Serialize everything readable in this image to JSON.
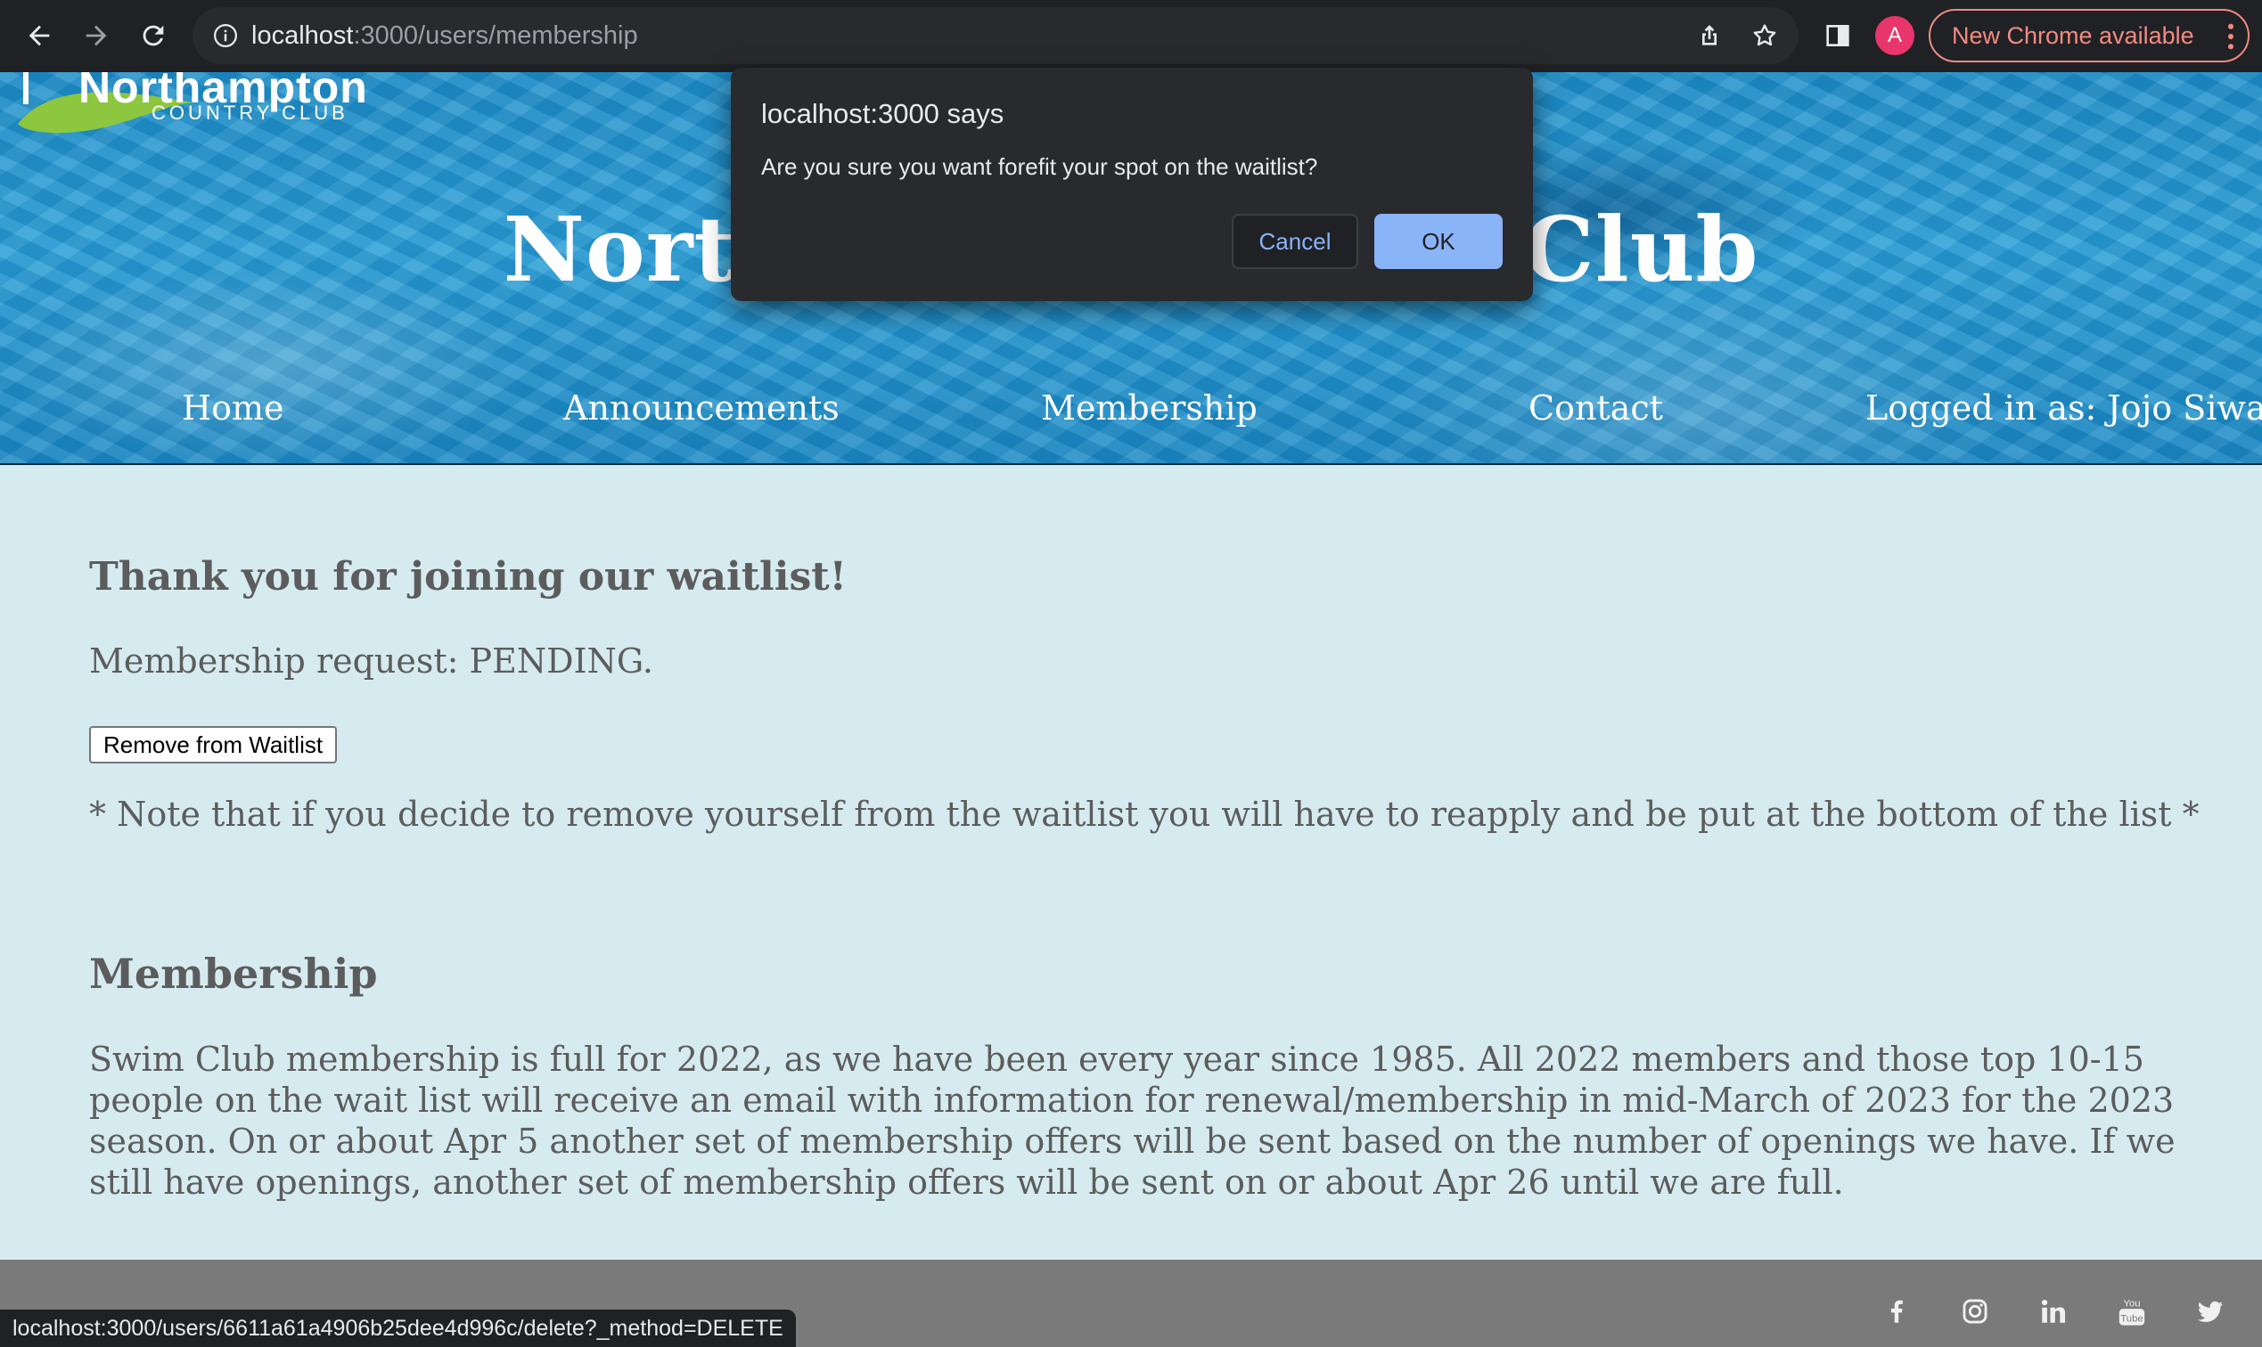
{
  "browser": {
    "url_host": "localhost",
    "url_path": ":3000/users/membership",
    "avatar_letter": "A",
    "update_label": "New Chrome available",
    "status_bar_url": "localhost:3000/users/6611a61a4906b25dee4d996c/delete?_method=DELETE"
  },
  "logo": {
    "word": "Northampton",
    "sub": "COUNTRY CLUB"
  },
  "hero": {
    "title": "Northampton Swim Club"
  },
  "nav": {
    "home": "Home",
    "announcements": "Announcements",
    "membership": "Membership",
    "contact": "Contact",
    "logged_in": "Logged in as: Jojo Siwa"
  },
  "waitlist": {
    "heading": "Thank you for joining our waitlist!",
    "status": "Membership request: PENDING.",
    "remove_button": "Remove from Waitlist",
    "note": "* Note that if you decide to remove yourself from the waitlist you will have to reapply and be put at the bottom of the list *"
  },
  "membership": {
    "heading": "Membership",
    "paragraph": "Swim Club membership is full for 2022, as we have been every year since 1985. All 2022 members and those top 10-15 people on the wait list will receive an email with information for renewal/membership in mid-March of 2023 for the 2023 season. On or about Apr 5 another set of membership offers will be sent based on the number of openings we have. If we still have openings, another set of membership offers will be sent on or about Apr 26 until we are full."
  },
  "footer": {
    "icons": [
      "facebook-icon",
      "instagram-icon",
      "linkedin-icon",
      "youtube-icon",
      "twitter-icon"
    ]
  },
  "dialog": {
    "title": "localhost:3000 says",
    "message": "Are you sure you want forefit your spot on the waitlist?",
    "cancel": "Cancel",
    "ok": "OK"
  },
  "colors": {
    "chrome_bg": "#202124",
    "page_bg": "#d6ebf0",
    "footer_bg": "#7a7a7a",
    "dialog_ok": "#8ab4f8",
    "update_accent": "#f28b82"
  }
}
